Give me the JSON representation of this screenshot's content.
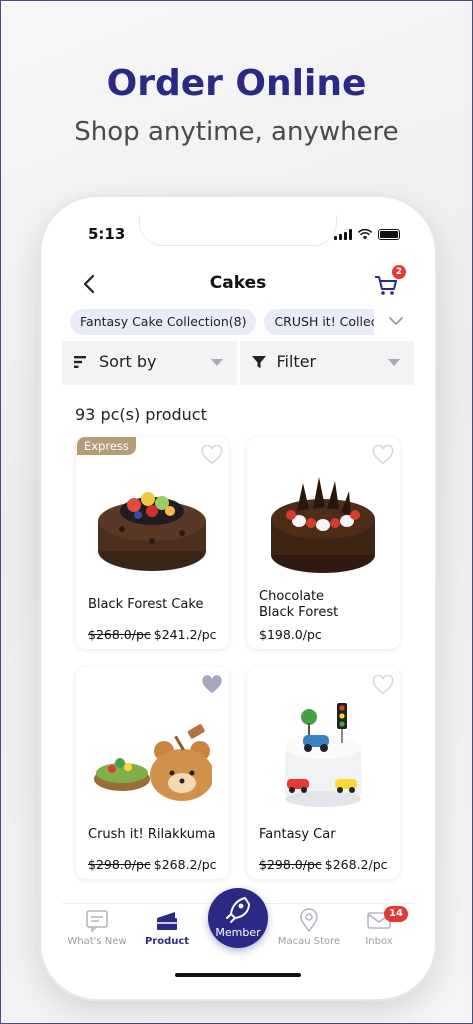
{
  "promo": {
    "headline": "Order Online",
    "subhead": "Shop anytime, anywhere"
  },
  "status": {
    "time": "5:13"
  },
  "nav": {
    "title": "Cakes",
    "cart_count": "2",
    "back_icon": "chevron-left-icon",
    "cart_icon": "cart-icon"
  },
  "categories": [
    {
      "label": "Fantasy Cake Collection(8)"
    },
    {
      "label": "CRUSH it! Collection"
    }
  ],
  "toolbar": {
    "sort_label": "Sort by",
    "filter_label": "Filter"
  },
  "results": {
    "count_text": "93 pc(s) product"
  },
  "products": [
    {
      "name": "Black Forest Cake",
      "old_price": "$268.0/pc",
      "price": "$241.2/pc",
      "badge": "Express",
      "favorited": false
    },
    {
      "name": "Chocolate\nBlack Forest",
      "old_price": "",
      "price": "$198.0/pc",
      "badge": "",
      "favorited": false
    },
    {
      "name": "Crush it! Rilakkuma",
      "old_price": "$298.0/pc",
      "price": "$268.2/pc",
      "badge": "",
      "favorited": true
    },
    {
      "name": "Fantasy Car",
      "old_price": "$298.0/pc",
      "price": "$268.2/pc",
      "badge": "",
      "favorited": false
    }
  ],
  "tabs": [
    {
      "label": "What's New",
      "icon": "news-icon"
    },
    {
      "label": "Product",
      "icon": "cake-icon"
    },
    {
      "label": "Member",
      "icon": "rocket-icon"
    },
    {
      "label": "Macau Store",
      "icon": "location-pin-icon"
    },
    {
      "label": "Inbox",
      "icon": "mail-icon",
      "badge": "14"
    }
  ],
  "colors": {
    "brand": "#2a2a84",
    "badge_red": "#e53935",
    "express_tag": "#b49c78",
    "chip_bg": "#e9ebf7"
  }
}
